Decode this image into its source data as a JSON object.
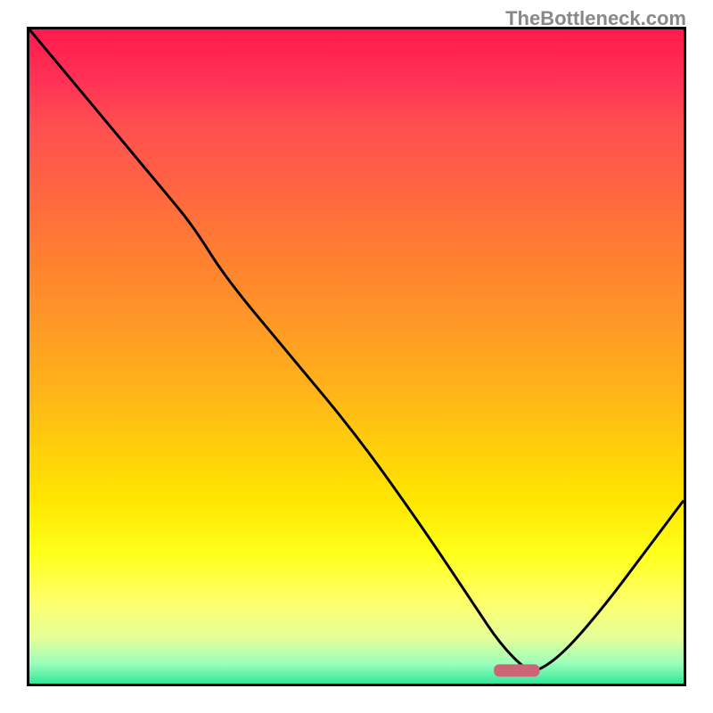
{
  "watermark": "TheBottleneck.com",
  "chart_data": {
    "type": "line",
    "title": "",
    "xlabel": "",
    "ylabel": "",
    "xlim": [
      0,
      100
    ],
    "ylim": [
      0,
      100
    ],
    "grid": false,
    "curve": {
      "x": [
        0,
        10,
        20,
        25,
        30,
        40,
        50,
        60,
        68,
        72,
        76,
        78,
        82,
        88,
        94,
        100
      ],
      "y": [
        100,
        88,
        76,
        70,
        62,
        50,
        38,
        24,
        12,
        6,
        2,
        2,
        5,
        12,
        20,
        28
      ]
    },
    "marker": {
      "x_start": 71,
      "x_end": 78,
      "y": 2,
      "color": "#cc6677"
    },
    "gradient_stops": [
      {
        "offset": 0,
        "color": "#ff1a4d"
      },
      {
        "offset": 8,
        "color": "#ff3355"
      },
      {
        "offset": 15,
        "color": "#ff5050"
      },
      {
        "offset": 25,
        "color": "#ff6640"
      },
      {
        "offset": 35,
        "color": "#ff8030"
      },
      {
        "offset": 45,
        "color": "#ff9926"
      },
      {
        "offset": 55,
        "color": "#ffb31a"
      },
      {
        "offset": 63,
        "color": "#ffcc0d"
      },
      {
        "offset": 72,
        "color": "#ffe600"
      },
      {
        "offset": 80,
        "color": "#ffff1a"
      },
      {
        "offset": 87,
        "color": "#ffff66"
      },
      {
        "offset": 93,
        "color": "#e6ff99"
      },
      {
        "offset": 97,
        "color": "#99ffbb"
      },
      {
        "offset": 100,
        "color": "#33e699"
      }
    ]
  }
}
